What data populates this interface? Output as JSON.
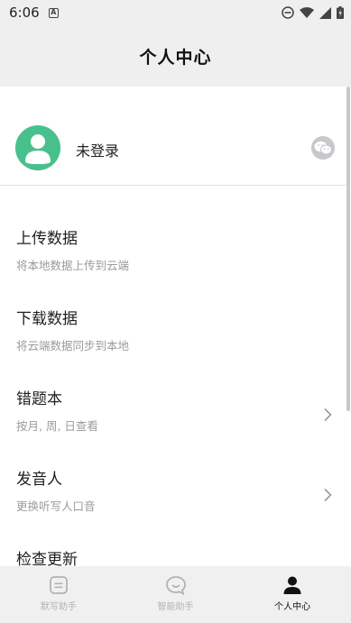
{
  "status_bar": {
    "time": "6:06",
    "notification_icon": "a-icon"
  },
  "header": {
    "title": "个人中心"
  },
  "profile": {
    "login_label": "未登录",
    "avatar_icon": "user-avatar-icon",
    "wechat_icon": "wechat-icon"
  },
  "menu": [
    {
      "title": "上传数据",
      "subtitle": "将本地数据上传到云端",
      "has_chevron": false
    },
    {
      "title": "下载数据",
      "subtitle": "将云端数据同步到本地",
      "has_chevron": false
    },
    {
      "title": "错题本",
      "subtitle": "按月, 周, 日查看",
      "has_chevron": true
    },
    {
      "title": "发音人",
      "subtitle": "更换听写人口音",
      "has_chevron": true
    },
    {
      "title": "检查更新",
      "subtitle": "",
      "has_chevron": false
    }
  ],
  "tabs": [
    {
      "label": "默写助手",
      "icon": "note-icon",
      "active": false
    },
    {
      "label": "智能助手",
      "icon": "chat-bubble-icon",
      "active": false
    },
    {
      "label": "个人中心",
      "icon": "person-icon",
      "active": true
    }
  ],
  "colors": {
    "accent": "#48c08c",
    "background_header": "#efefef",
    "text_secondary": "#9b9b9b"
  }
}
